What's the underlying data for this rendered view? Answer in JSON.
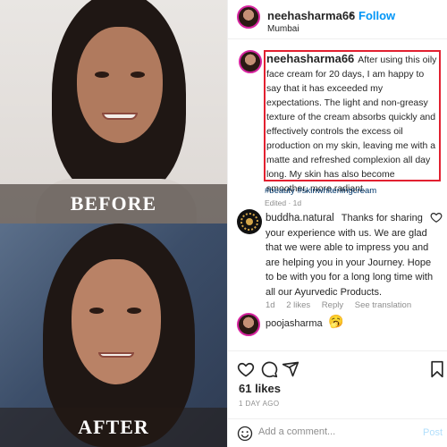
{
  "media": {
    "before_label": "BEFORE",
    "after_label": "AFTER"
  },
  "header": {
    "username": "neehasharma66",
    "dot": "•",
    "follow_label": "Follow",
    "location": "Mumbai"
  },
  "caption": {
    "username": "neehasharma66",
    "text": "After using this oily face cream for 20 days, I am happy to say that it has exceeded my expectations. The light and non-greasy texture of the cream absorbs quickly and effectively controls the excess oil production on my skin, leaving me with a matte and refreshed complexion all day long. My skin has also become smoother, more radiant.",
    "hashtags": "#beauty #skinwhiteningcream",
    "edited": "Edited · 1d"
  },
  "comment": {
    "username": "buddha.natural",
    "text": "Thanks for sharing your experience with us. We are glad that we were able to impress you and are helping you in your Journey. Hope to be with you for a long long time with all our Ayurvedic Products.",
    "time": "1d",
    "likes": "2 likes",
    "reply_label": "Reply",
    "translate_label": "See translation"
  },
  "reply_comment": {
    "username": "poojasharma",
    "emoji": "🥱"
  },
  "footer": {
    "likes": "61 likes",
    "date": "1 DAY AGO",
    "comment_placeholder": "Add a comment...",
    "post_label": "Post"
  },
  "icons": {
    "like": "heart-icon",
    "comment": "comment-icon",
    "share": "share-icon",
    "save": "bookmark-icon",
    "emoji": "smiley-icon"
  },
  "colors": {
    "follow": "#0095f6",
    "highlight_box": "#e22030",
    "hashtag": "#00376b",
    "muted": "#8e8e8e"
  }
}
